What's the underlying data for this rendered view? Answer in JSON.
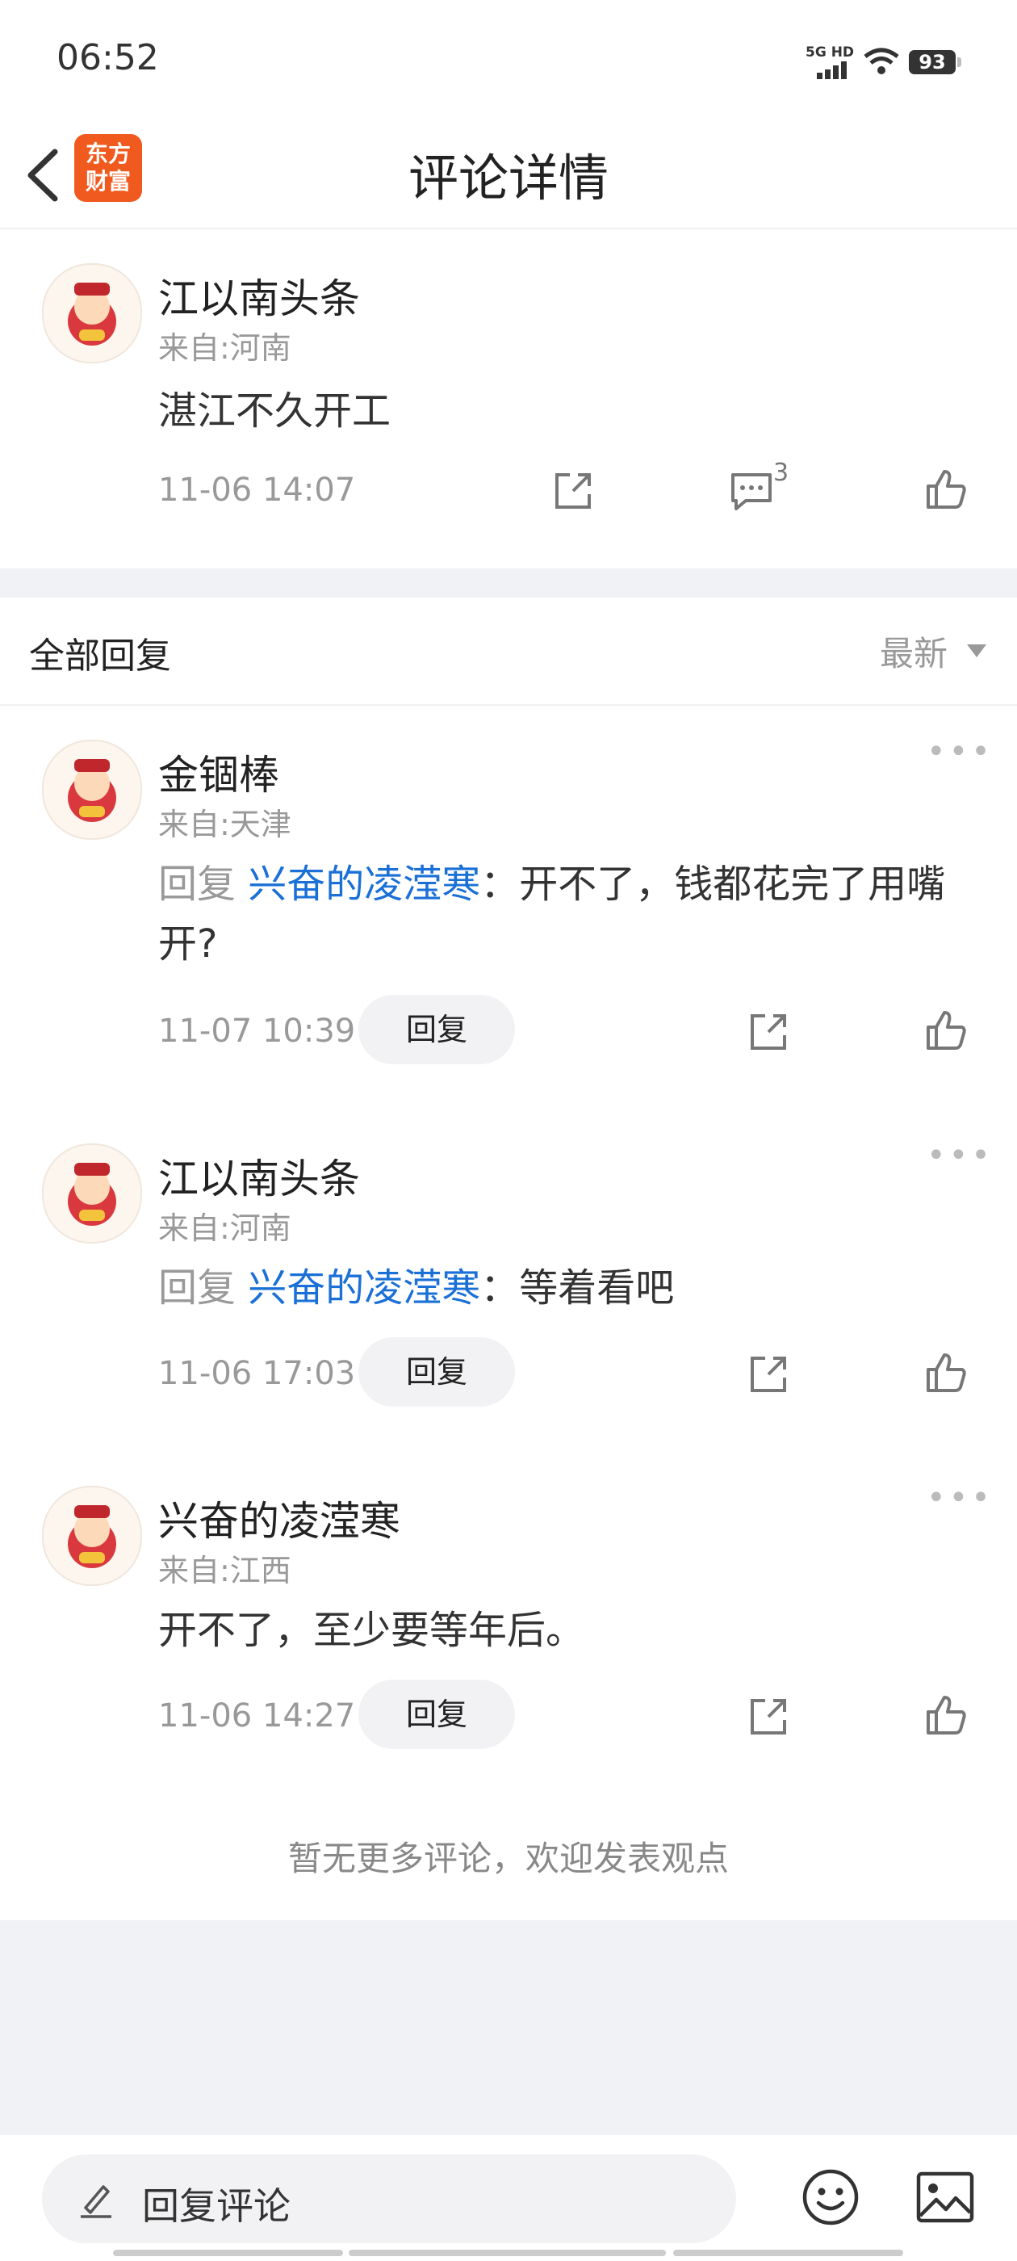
{
  "status_bar": {
    "time": "06:52",
    "network": "5G HD",
    "battery": "93"
  },
  "header": {
    "logo_line1": "东方",
    "logo_line2": "财富",
    "title": "评论详情"
  },
  "main_comment": {
    "author": "江以南头条",
    "location": "来自:河南",
    "text": "湛江不久开工",
    "time": "11-06 14:07",
    "comment_count": "3"
  },
  "replies_header": {
    "label": "全部回复",
    "sort": "最新"
  },
  "replies": [
    {
      "author": "金锢棒",
      "location": "来自:天津",
      "prefix": "回复 ",
      "mention": "兴奋的凌滢寒",
      "text": "：开不了，钱都花完了用嘴开?",
      "time": "11-07 10:39",
      "reply_label": "回复"
    },
    {
      "author": "江以南头条",
      "location": "来自:河南",
      "prefix": "回复 ",
      "mention": "兴奋的凌滢寒",
      "text": "：等着看吧",
      "time": "11-06 17:03",
      "reply_label": "回复"
    },
    {
      "author": "兴奋的凌滢寒",
      "location": "来自:江西",
      "prefix": "",
      "mention": "",
      "text": "开不了，至少要等年后。",
      "time": "11-06 14:27",
      "reply_label": "回复"
    }
  ],
  "no_more": "暂无更多评论，欢迎发表观点",
  "bottom_bar": {
    "placeholder": "回复评论"
  },
  "colors": {
    "brand": "#f05a1e",
    "mention": "#1a70d6",
    "muted": "#999999"
  },
  "icons": [
    "back-icon",
    "share-icon",
    "comment-icon",
    "like-icon",
    "more-icon",
    "pencil-icon",
    "emoji-icon",
    "image-icon"
  ]
}
